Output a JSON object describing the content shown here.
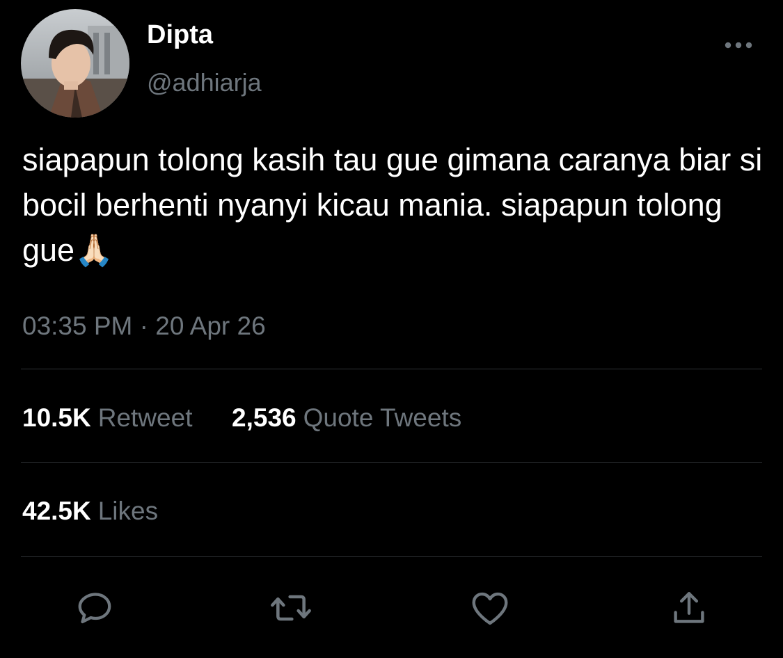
{
  "author": {
    "display_name": "Dipta",
    "handle": "@adhiarja"
  },
  "tweet": {
    "text": "siapapun tolong kasih tau gue gimana caranya biar si bocil berhenti nyanyi kicau mania. siapapun tolong gue🙏🏻",
    "timestamp": "03:35 PM · 20 Apr 26"
  },
  "stats": {
    "retweets_count": "10.5K",
    "retweets_label": "Retweet",
    "quotes_count": "2,536",
    "quotes_label": "Quote Tweets",
    "likes_count": "42.5K",
    "likes_label": "Likes"
  },
  "actions": {
    "icons": [
      "reply-icon",
      "retweet-icon",
      "like-icon",
      "share-icon"
    ]
  },
  "colors": {
    "background": "#000000",
    "primary_text": "#ffffff",
    "secondary_text": "#6e767d",
    "divider": "#2f3336",
    "icon": "#6e767d"
  }
}
